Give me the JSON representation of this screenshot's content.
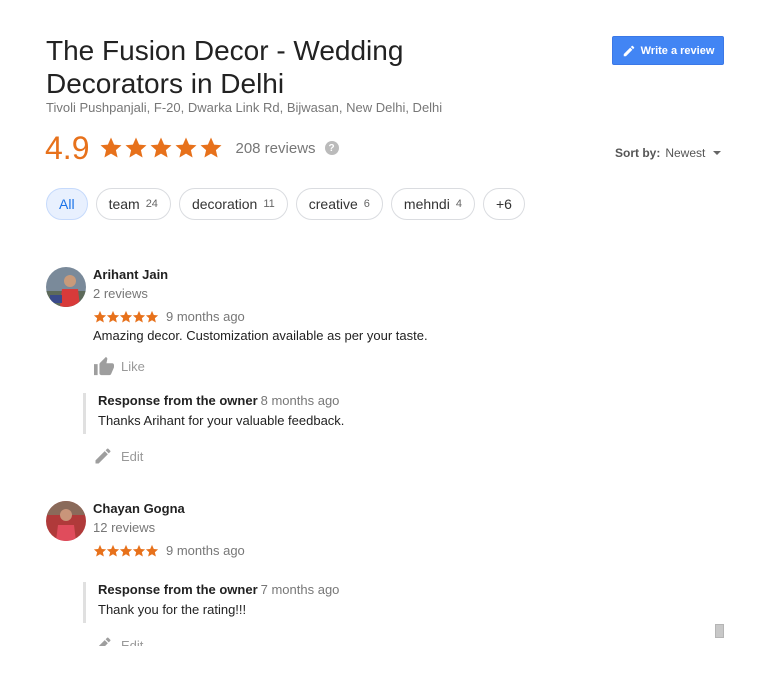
{
  "place": {
    "title": "The Fusion Decor - Wedding Decorators in Delhi",
    "address": "Tivoli Pushpanjali, F-20, Dwarka Link Rd, Bijwasan, New Delhi, Delhi"
  },
  "write_review": {
    "label": "Write a review",
    "icon": "pencil-icon"
  },
  "rating": {
    "value": "4.9",
    "stars": 5,
    "reviews_label": "208 reviews",
    "help": "?"
  },
  "sort": {
    "label": "Sort by:",
    "value": "Newest"
  },
  "chips": [
    {
      "label": "All",
      "count": "",
      "active": true
    },
    {
      "label": "team",
      "count": "24",
      "active": false
    },
    {
      "label": "decoration",
      "count": "11",
      "active": false
    },
    {
      "label": "creative",
      "count": "6",
      "active": false
    },
    {
      "label": "mehndi",
      "count": "4",
      "active": false
    },
    {
      "label": "+6",
      "count": "",
      "active": false
    }
  ],
  "reviews": [
    {
      "name": "Arihant Jain",
      "sub": "2 reviews",
      "stars": 5,
      "time": "9 months ago",
      "text": "Amazing decor. Customization available as per your taste.",
      "like_label": "Like",
      "owner_title": "Response from the owner",
      "owner_time": "8 months ago",
      "owner_text": "Thanks Arihant for your valuable feedback.",
      "edit_label": "Edit"
    },
    {
      "name": "Chayan Gogna",
      "sub": "12 reviews",
      "stars": 5,
      "time": "9 months ago",
      "owner_title": "Response from the owner",
      "owner_time": "7 months ago",
      "owner_text": "Thank you for the rating!!!",
      "edit_label": "Edit"
    }
  ],
  "colors": {
    "star": "#e7711b",
    "accent": "#4285f4"
  }
}
